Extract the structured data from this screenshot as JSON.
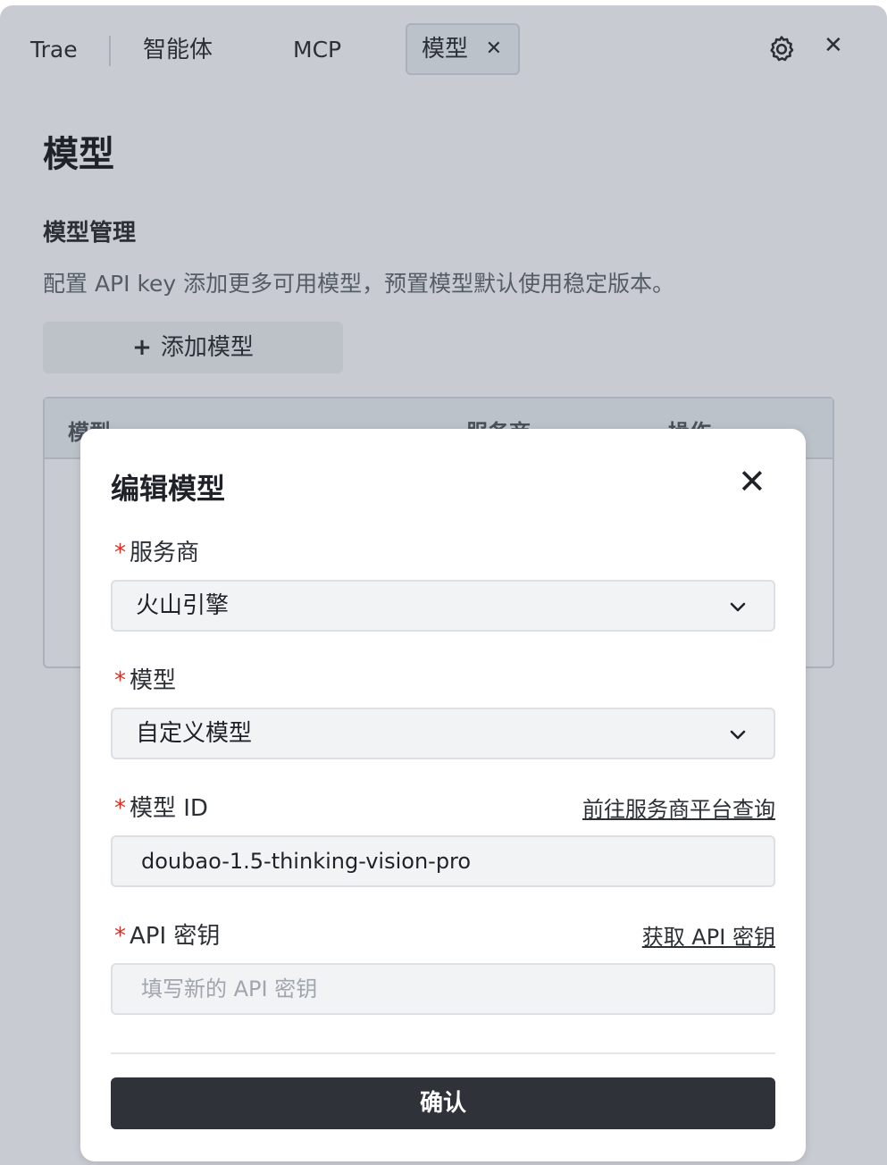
{
  "tabs": {
    "trae": "Trae",
    "agent": "智能体",
    "mcp": "MCP",
    "model": "模型",
    "close_glyph": "✕"
  },
  "window": {
    "close_glyph": "✕"
  },
  "page": {
    "title": "模型",
    "section_title": "模型管理",
    "section_desc": "配置 API key 添加更多可用模型，预置模型默认使用稳定版本。",
    "add_plus": "+",
    "add_label": "添加模型"
  },
  "table": {
    "headers": {
      "model": "模型",
      "provider": "服务商",
      "ops": "操作"
    }
  },
  "modal": {
    "title": "编辑模型",
    "close_glyph": "✕",
    "required_mark": "*",
    "provider_label": "服务商",
    "provider_value": "火山引擎",
    "model_label": "模型",
    "model_value": "自定义模型",
    "model_id_label": "模型 ID",
    "model_id_link": "前往服务商平台查询",
    "model_id_value": "doubao-1.5-thinking-vision-pro",
    "api_key_label": "API 密钥",
    "api_key_link": "获取 API 密钥",
    "api_key_placeholder": "填写新的 API 密钥",
    "confirm_label": "确认"
  },
  "colors": {
    "required": "#d93025",
    "confirm_bg": "#2f3238",
    "overlay_bg": "#c8ccd2"
  }
}
